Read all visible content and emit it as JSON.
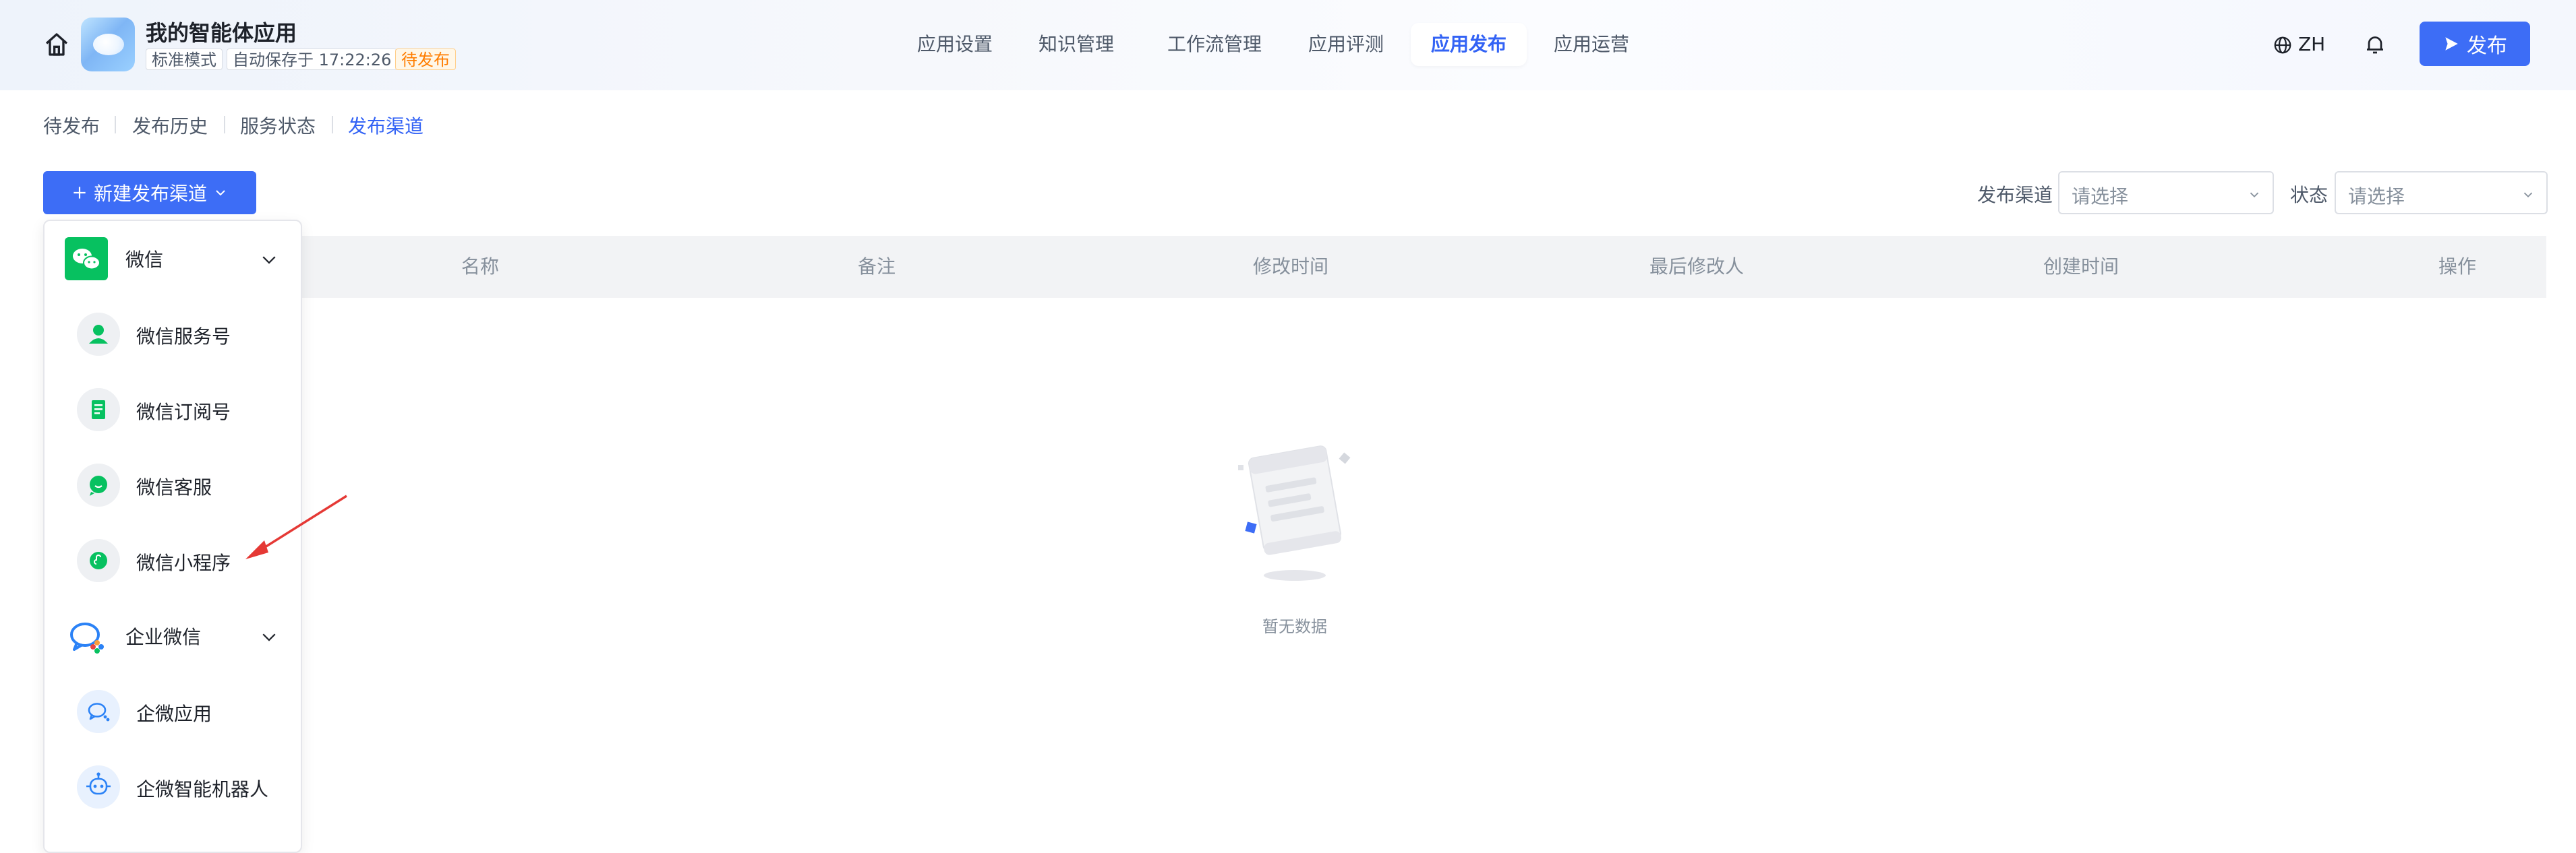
{
  "header": {
    "app_name": "我的智能体应用",
    "tags": {
      "mode": "标准模式",
      "autosave": "自动保存于 17:22:26",
      "status": "待发布"
    },
    "nav": [
      "应用设置",
      "知识管理",
      "工作流管理",
      "应用评测",
      "应用发布",
      "应用运营"
    ],
    "active_nav": "应用发布",
    "lang": "ZH",
    "publish_label": "发布"
  },
  "subtabs": [
    "待发布",
    "发布历史",
    "服务状态",
    "发布渠道"
  ],
  "active_subtab": "发布渠道",
  "new_channel_label": "新建发布渠道",
  "filters": {
    "channel_label": "发布渠道",
    "channel_placeholder": "请选择",
    "status_label": "状态",
    "status_placeholder": "请选择"
  },
  "table": {
    "columns": [
      "名称",
      "备注",
      "修改时间",
      "最后修改人",
      "创建时间",
      "操作"
    ]
  },
  "empty_text": "暂无数据",
  "dropdown": {
    "groups": [
      {
        "label": "微信",
        "items": [
          "微信服务号",
          "微信订阅号",
          "微信客服",
          "微信小程序"
        ]
      },
      {
        "label": "企业微信",
        "items": [
          "企微应用",
          "企微智能机器人"
        ]
      }
    ]
  },
  "colors": {
    "primary": "#3d6df6",
    "active_text": "#3363f5",
    "wechat_green": "#07c160",
    "wework_blue": "#2b82f6",
    "warn": "#ff7d00",
    "annotation_arrow": "#e53935"
  },
  "icons": {
    "home": "home-icon",
    "globe": "globe-icon",
    "bell": "bell-icon",
    "send": "send-icon",
    "plus": "plus-icon",
    "chevron": "chevron-down-icon"
  }
}
